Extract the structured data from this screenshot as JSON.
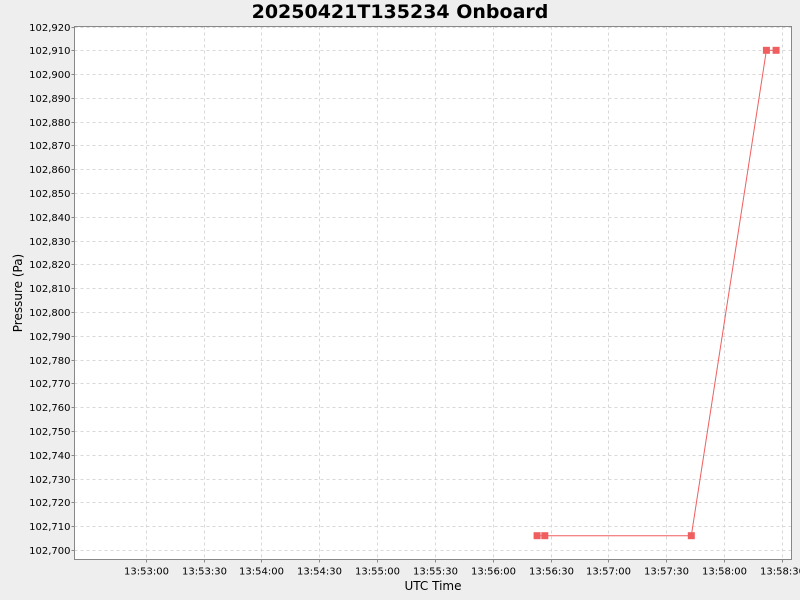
{
  "colors": {
    "page_background": "#eeeeee",
    "plot_background": "#ffffff",
    "series": "#ef5f5f",
    "grid": "#d8d8d8",
    "axis": "#888888"
  },
  "chart_data": {
    "type": "line",
    "title": "20250421T135234 Onboard",
    "xlabel": "UTC Time",
    "ylabel": "Pressure (Pa)",
    "xlim": [
      "13:52:23",
      "13:58:35"
    ],
    "ylim": [
      102696,
      102920
    ],
    "x_ticks": [
      "13:53:00",
      "13:53:30",
      "13:54:00",
      "13:54:30",
      "13:55:00",
      "13:55:30",
      "13:56:00",
      "13:56:30",
      "13:57:00",
      "13:57:30",
      "13:58:00",
      "13:58:30"
    ],
    "y_ticks": [
      102700,
      102710,
      102720,
      102730,
      102740,
      102750,
      102760,
      102770,
      102780,
      102790,
      102800,
      102810,
      102820,
      102830,
      102840,
      102850,
      102860,
      102870,
      102880,
      102890,
      102900,
      102910,
      102920
    ],
    "y_tick_labels": [
      "102,700",
      "102,710",
      "102,720",
      "102,730",
      "102,740",
      "102,750",
      "102,760",
      "102,770",
      "102,780",
      "102,790",
      "102,800",
      "102,810",
      "102,820",
      "102,830",
      "102,840",
      "102,850",
      "102,860",
      "102,870",
      "102,880",
      "102,890",
      "102,900",
      "102,910",
      "102,920"
    ],
    "grid": true,
    "legend": "none",
    "series": [
      {
        "marker": "square",
        "points": [
          {
            "x": "13:56:23",
            "y": 102706
          },
          {
            "x": "13:56:27",
            "y": 102706
          },
          {
            "x": "13:57:43",
            "y": 102706
          },
          {
            "x": "13:58:22",
            "y": 102910
          },
          {
            "x": "13:58:27",
            "y": 102910
          }
        ]
      }
    ]
  }
}
